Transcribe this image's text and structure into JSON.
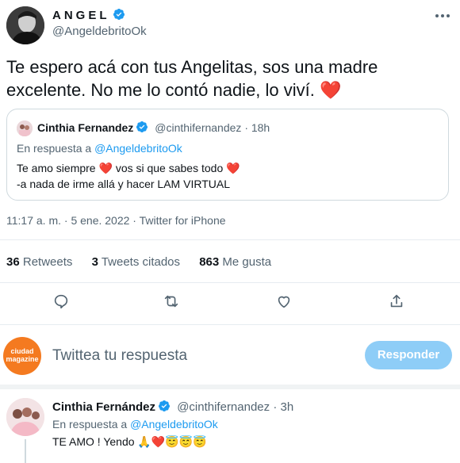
{
  "main_tweet": {
    "display_name": "ANGEL",
    "handle": "@AngeldebritoOk",
    "text": "Te espero acá con tus Angelitas, sos una madre excelente. No me lo contó nadie, lo viví.",
    "heart": "❤️",
    "more_icon": "more-dots-icon",
    "timestamp": "11:17 a. m. · 5 ene. 2022 · Twitter for iPhone"
  },
  "quoted_tweet": {
    "display_name": "Cinthia Fernandez",
    "handle": "@cinthifernandez",
    "age": "· 18h",
    "reply_prefix": "En respuesta a",
    "reply_to": "@AngeldebritoOk",
    "line1_a": "Te amo siempre",
    "line1_b": "vos si que sabes todo",
    "heart": "❤️",
    "line2": "-a nada de irme allá y hacer LAM VIRTUAL"
  },
  "stats": {
    "retweets_count": "36",
    "retweets_label": "Retweets",
    "quotes_count": "3",
    "quotes_label": "Tweets citados",
    "likes_count": "863",
    "likes_label": "Me gusta"
  },
  "actions": [
    "reply-icon",
    "retweet-icon",
    "like-icon",
    "share-icon"
  ],
  "composer": {
    "avatar_text_line1": "ciudad",
    "avatar_text_line2": "magazine",
    "placeholder": "Twittea tu respuesta",
    "button_label": "Responder"
  },
  "reply": {
    "display_name": "Cinthia Fernández",
    "handle": "@cinthifernandez",
    "age": "· 3h",
    "reply_prefix": "En respuesta a",
    "reply_to": "@AngeldebritoOk",
    "text": "TE AMO ! Yendo",
    "emojis": "🙏❤️😇😇😇"
  },
  "colors": {
    "accent": "#1d9bf0",
    "button_disabled": "#8ecdf7",
    "heart": "#e0245e"
  }
}
